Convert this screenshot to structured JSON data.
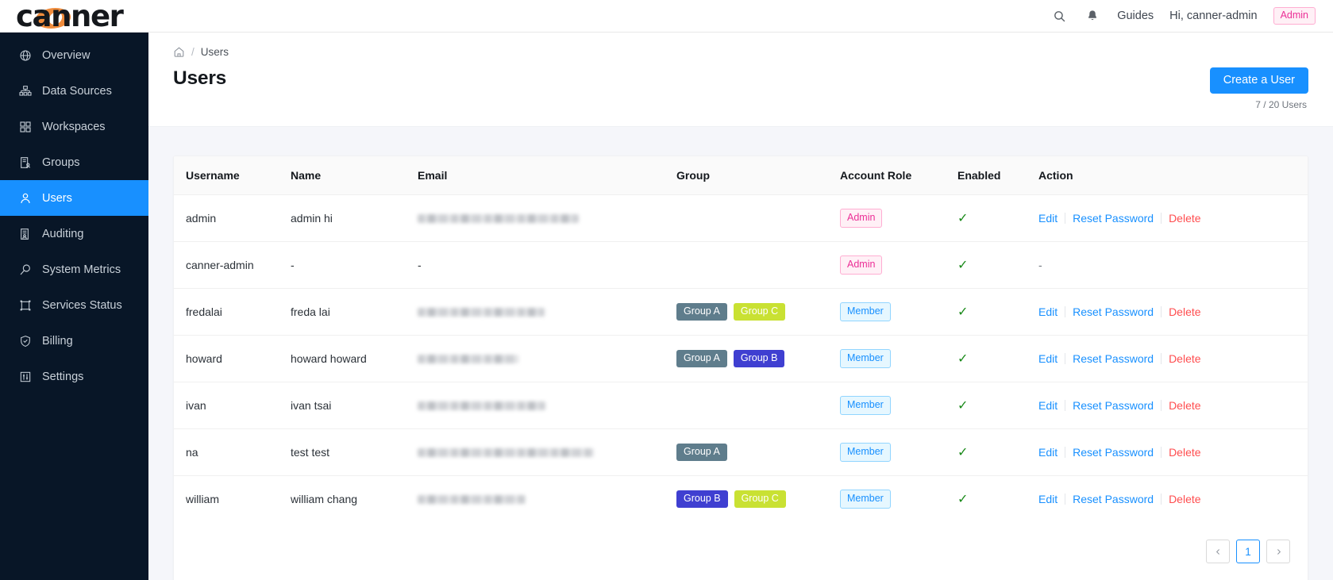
{
  "topbar": {
    "logo_text": "canner",
    "search_icon": "search-icon",
    "notification_icon": "bell-icon",
    "guides_label": "Guides",
    "greeting": "Hi, canner-admin",
    "role_badge": "Admin"
  },
  "sidebar": {
    "items": [
      {
        "label": "Overview",
        "icon": "globe-icon",
        "active": false
      },
      {
        "label": "Data Sources",
        "icon": "database-icon",
        "active": false
      },
      {
        "label": "Workspaces",
        "icon": "grid-icon",
        "active": false
      },
      {
        "label": "Groups",
        "icon": "group-doc-icon",
        "active": false
      },
      {
        "label": "Users",
        "icon": "user-icon",
        "active": true
      },
      {
        "label": "Auditing",
        "icon": "audit-doc-icon",
        "active": false
      },
      {
        "label": "System Metrics",
        "icon": "magnifier-icon",
        "active": false
      },
      {
        "label": "Services Status",
        "icon": "frame-icon",
        "active": false
      },
      {
        "label": "Billing",
        "icon": "shield-check-icon",
        "active": false
      },
      {
        "label": "Settings",
        "icon": "sliders-icon",
        "active": false
      }
    ]
  },
  "breadcrumb": {
    "home_icon": "home-icon",
    "separator": "/",
    "current": "Users"
  },
  "page": {
    "title": "Users",
    "create_button": "Create a User",
    "user_count": "7 / 20 Users"
  },
  "table": {
    "columns": [
      "Username",
      "Name",
      "Email",
      "Group",
      "Account Role",
      "Enabled",
      "Action"
    ],
    "rows": [
      {
        "username": "admin",
        "name": "admin hi",
        "email_redacted": true,
        "email_width": 203,
        "groups": [],
        "role": "Admin",
        "role_type": "admin",
        "enabled": true,
        "actions": [
          "Edit",
          "Reset Password",
          "Delete"
        ]
      },
      {
        "username": "canner-admin",
        "name": "-",
        "email_redacted": false,
        "email_text": "-",
        "groups": [],
        "role": "Admin",
        "role_type": "admin",
        "enabled": true,
        "actions": [],
        "action_dash": "-"
      },
      {
        "username": "fredalai",
        "name": "freda lai",
        "email_redacted": true,
        "email_width": 160,
        "groups": [
          {
            "label": "Group A",
            "color": "a"
          },
          {
            "label": "Group C",
            "color": "c"
          }
        ],
        "role": "Member",
        "role_type": "member",
        "enabled": true,
        "actions": [
          "Edit",
          "Reset Password",
          "Delete"
        ]
      },
      {
        "username": "howard",
        "name": "howard howard",
        "email_redacted": true,
        "email_width": 127,
        "groups": [
          {
            "label": "Group A",
            "color": "a"
          },
          {
            "label": "Group B",
            "color": "b"
          }
        ],
        "role": "Member",
        "role_type": "member",
        "enabled": true,
        "actions": [
          "Edit",
          "Reset Password",
          "Delete"
        ]
      },
      {
        "username": "ivan",
        "name": "ivan tsai",
        "email_redacted": true,
        "email_width": 161,
        "groups": [],
        "role": "Member",
        "role_type": "member",
        "enabled": true,
        "actions": [
          "Edit",
          "Reset Password",
          "Delete"
        ]
      },
      {
        "username": "na",
        "name": "test test",
        "email_redacted": true,
        "email_width": 222,
        "groups": [
          {
            "label": "Group A",
            "color": "a"
          }
        ],
        "role": "Member",
        "role_type": "member",
        "enabled": true,
        "actions": [
          "Edit",
          "Reset Password",
          "Delete"
        ]
      },
      {
        "username": "william",
        "name": "william chang",
        "email_redacted": true,
        "email_width": 136,
        "groups": [
          {
            "label": "Group B",
            "color": "b"
          },
          {
            "label": "Group C",
            "color": "c"
          }
        ],
        "role": "Member",
        "role_type": "member",
        "enabled": true,
        "actions": [
          "Edit",
          "Reset Password",
          "Delete"
        ]
      }
    ],
    "enabled_glyph": "✓"
  },
  "pagination": {
    "prev_icon": "chevron-left-icon",
    "next_icon": "chevron-right-icon",
    "pages": [
      "1"
    ],
    "current_page": "1"
  },
  "colors": {
    "accent": "#1890ff",
    "sidebar_bg": "#081627",
    "logo_orange": "#f08c3c",
    "admin_pink": "#eb2f96",
    "danger_red": "#ff4d4f",
    "check_green": "#1a8a1a",
    "group_a": "#5f7d8c",
    "group_b": "#3f3fd1",
    "group_c": "#c9e133"
  }
}
